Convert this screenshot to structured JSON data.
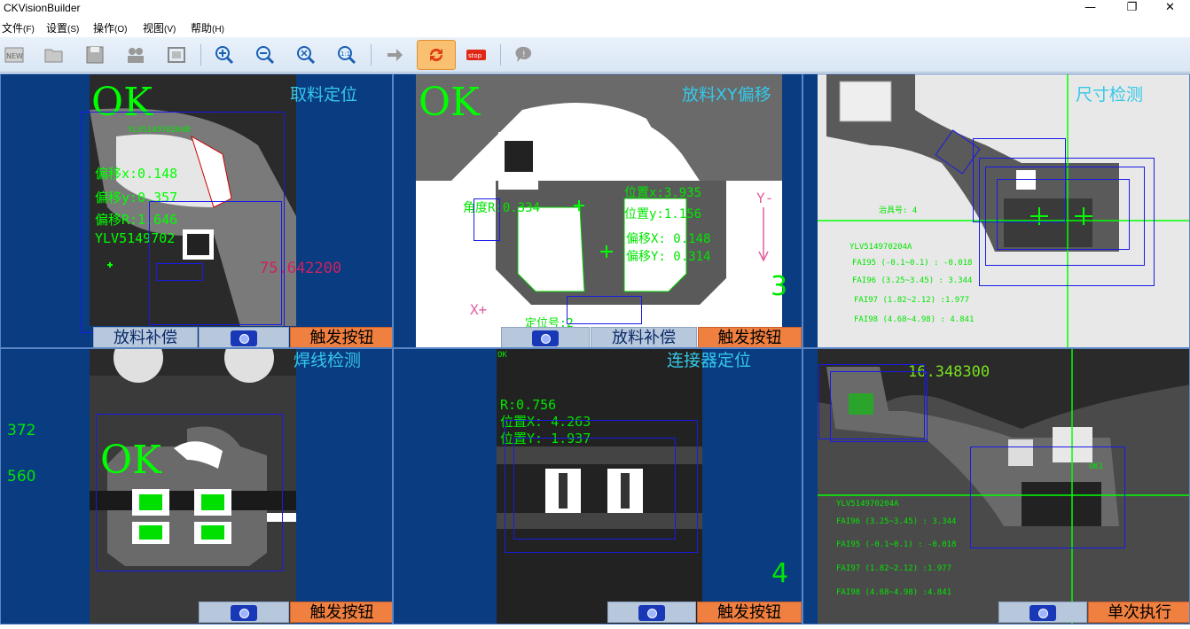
{
  "window": {
    "title": "CKVisionBuilder",
    "minimize": "—",
    "maximize": "❐",
    "close": "✕"
  },
  "menu": [
    {
      "label": "文件",
      "key": "(F)"
    },
    {
      "label": "设置",
      "key": "(S)"
    },
    {
      "label": "操作",
      "key": "(O)"
    },
    {
      "label": "视图",
      "key": "(V)"
    },
    {
      "label": "帮助",
      "key": "(H)"
    }
  ],
  "toolbar": {
    "icons": [
      "new-icon",
      "open-icon",
      "save-icon",
      "users-icon",
      "fit-icon",
      "zoom-in-icon",
      "zoom-out-icon",
      "zoom-fit-icon",
      "zoom-actual-icon",
      "step-icon",
      "run-cycle-icon",
      "stop-icon",
      "help-icon"
    ],
    "stop_label": "stop",
    "zoom_actual_label": "1:1",
    "new_label": "NEW"
  },
  "colors": {
    "workspace": "#0a3c82",
    "ok": "#00ff00",
    "title": "#34c8e8",
    "roi": "#1a1ae6",
    "trigger": "#f08040",
    "compensate": "#b8c8dc"
  },
  "panels": {
    "p1": {
      "title": "取料定位",
      "status": "OK",
      "code": "YLV514970204B",
      "off_x": "偏移x:0.148",
      "off_y": "偏移y:0.357",
      "off_r": "偏移R:1.646",
      "code2": "YLV5149702",
      "value": "75.642200",
      "btn_comp": "放料补偿",
      "btn_trig": "触发按钮"
    },
    "p2": {
      "title": "放料XY偏移",
      "status": "OK",
      "angle": "角度R:0.334",
      "pos_x": "位置x:3.935",
      "pos_y": "位置y:1.156",
      "off_x": "偏移X: 0.148",
      "off_y": "偏移Y: 0.314",
      "y_axis": "Y-",
      "x_axis": "X+",
      "pos_label": "定位号:2",
      "count": "3",
      "btn_comp": "放料补偿",
      "btn_trig": "触发按钮"
    },
    "p3": {
      "title": "尺寸检测",
      "fixture": "治具号: 4",
      "code": "YLV514970204A",
      "fai": [
        "FAI95 (-0.1~0.1) : -0.018",
        "FAI96 (3.25~3.45) : 3.344",
        "FAI97 (1.82~2.12) :1.977",
        "FAI98 (4.68~4.98) : 4.841"
      ]
    },
    "p4": {
      "title": "焊线检测",
      "status": "OK",
      "n1": "372",
      "n2": "560",
      "btn_trig": "触发按钮"
    },
    "p5": {
      "title": "连接器定位",
      "status": "OK",
      "r": "R:0.756",
      "pos_x": "位置X: 4.263",
      "pos_y": "位置Y: 1.937",
      "count": "4",
      "btn_trig": "触发按钮"
    },
    "p6": {
      "value": "16.348300",
      "code": "YLV514970204A",
      "ok_small": "OK1",
      "fai": [
        "FAI96 (3.25~3.45) : 3.344",
        "FAI95 (-0.1~0.1) : -0.018",
        "FAI97 (1.82~2.12) :1.977",
        "FAI98 (4.68~4.98) :4.841"
      ],
      "btn_run": "单次执行"
    }
  }
}
